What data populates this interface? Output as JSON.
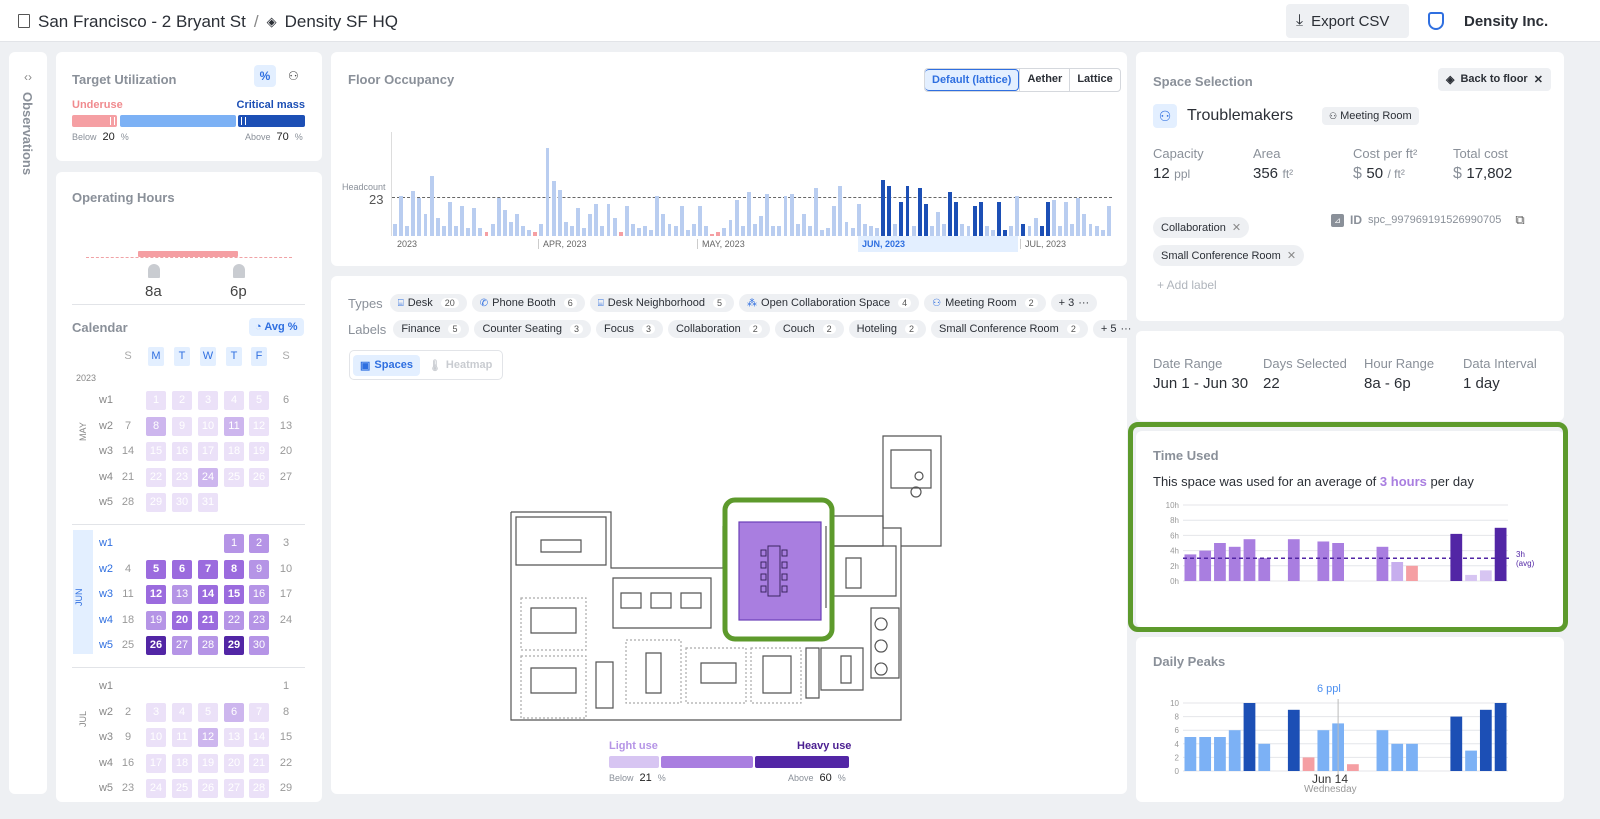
{
  "header": {
    "building": "San Francisco - 2 Bryant St",
    "separator": "/",
    "space": "Density SF HQ",
    "export": "Export CSV",
    "org": "Density Inc."
  },
  "side_tab": {
    "label": "Observations"
  },
  "target": {
    "title": "Target Utilization",
    "pct": "%",
    "underuse": "Underuse",
    "critical": "Critical mass",
    "below": "Below",
    "below_val": "20",
    "above": "Above",
    "above_val": "70",
    "unit": "%",
    "level_low": 0.2,
    "level_high": 0.7
  },
  "hours": {
    "title": "Operating Hours",
    "start": "8a",
    "end": "6p"
  },
  "calendar": {
    "title": "Calendar",
    "avg": "Avg %",
    "year": "2023",
    "days": [
      "S",
      "M",
      "T",
      "W",
      "T",
      "F",
      "S"
    ],
    "months": [
      {
        "name": "MAY",
        "rows": [
          {
            "w": "w1",
            "cells": [
              "",
              "1",
              "2",
              "3",
              "4",
              "5",
              "6"
            ]
          },
          {
            "w": "w2",
            "cells": [
              "7",
              "8",
              "9",
              "10",
              "11",
              "12",
              "13"
            ]
          },
          {
            "w": "w3",
            "cells": [
              "14",
              "15",
              "16",
              "17",
              "18",
              "19",
              "20"
            ]
          },
          {
            "w": "w4",
            "cells": [
              "21",
              "22",
              "23",
              "24",
              "25",
              "26",
              "27"
            ]
          },
          {
            "w": "w5",
            "cells": [
              "28",
              "29",
              "30",
              "31",
              "",
              "",
              ""
            ]
          }
        ]
      },
      {
        "name": "JUN",
        "rows": [
          {
            "w": "w1",
            "cells": [
              "",
              "",
              "",
              "",
              "1",
              "2",
              "3"
            ]
          },
          {
            "w": "w2",
            "cells": [
              "4",
              "5",
              "6",
              "7",
              "8",
              "9",
              "10"
            ]
          },
          {
            "w": "w3",
            "cells": [
              "11",
              "12",
              "13",
              "14",
              "15",
              "16",
              "17"
            ]
          },
          {
            "w": "w4",
            "cells": [
              "18",
              "19",
              "20",
              "21",
              "22",
              "23",
              "24"
            ]
          },
          {
            "w": "w5",
            "cells": [
              "25",
              "26",
              "27",
              "28",
              "29",
              "30",
              ""
            ]
          }
        ]
      },
      {
        "name": "JUL",
        "rows": [
          {
            "w": "w1",
            "cells": [
              "",
              "",
              "",
              "",
              "",
              "",
              "1"
            ]
          },
          {
            "w": "w2",
            "cells": [
              "2",
              "3",
              "4",
              "5",
              "6",
              "7",
              "8"
            ]
          },
          {
            "w": "w3",
            "cells": [
              "9",
              "10",
              "11",
              "12",
              "13",
              "14",
              "15"
            ]
          },
          {
            "w": "w4",
            "cells": [
              "16",
              "17",
              "18",
              "19",
              "20",
              "21",
              "22"
            ]
          },
          {
            "w": "w5",
            "cells": [
              "23",
              "24",
              "25",
              "26",
              "27",
              "28",
              "29"
            ]
          }
        ]
      }
    ]
  },
  "occupancy": {
    "title": "Floor Occupancy",
    "tabs": [
      "Default (lattice)",
      "Aether",
      "Lattice"
    ],
    "ylabel": "Headcount",
    "ref": "23",
    "months": [
      "2023",
      "APR, 2023",
      "MAY, 2023",
      "JUN, 2023",
      "JUL, 2023"
    ]
  },
  "filters": {
    "types_label": "Types",
    "types": [
      {
        "name": "Desk",
        "n": "20",
        "icon": "desk-icon"
      },
      {
        "name": "Phone Booth",
        "n": "6",
        "icon": "phone-icon"
      },
      {
        "name": "Desk Neighborhood",
        "n": "5",
        "icon": "desk-icon"
      },
      {
        "name": "Open Collaboration Space",
        "n": "4",
        "icon": "collab-icon"
      },
      {
        "name": "Meeting Room",
        "n": "2",
        "icon": "meeting-icon"
      }
    ],
    "types_more": "+ 3",
    "labels_label": "Labels",
    "labels": [
      {
        "name": "Finance",
        "n": "5"
      },
      {
        "name": "Counter Seating",
        "n": "3"
      },
      {
        "name": "Focus",
        "n": "3"
      },
      {
        "name": "Collaboration",
        "n": "2"
      },
      {
        "name": "Couch",
        "n": "2"
      },
      {
        "name": "Hoteling",
        "n": "2"
      },
      {
        "name": "Small Conference Room",
        "n": "2"
      }
    ],
    "labels_more": "+ 5",
    "view_spaces": "Spaces",
    "view_heatmap": "Heatmap"
  },
  "legend": {
    "light": "Light use",
    "heavy": "Heavy use",
    "below": "Below",
    "below_val": "21",
    "above": "Above",
    "above_val": "60",
    "unit": "%",
    "level_low": 0.21,
    "level_high": 0.6
  },
  "selection": {
    "title": "Space Selection",
    "back": "Back to floor",
    "name": "Troublemakers",
    "type": "Meeting Room",
    "stats": [
      {
        "label": "Capacity",
        "value": "12",
        "unit": "ppl",
        "prefix": ""
      },
      {
        "label": "Area",
        "value": "356",
        "unit": "ft²",
        "prefix": ""
      },
      {
        "label": "Cost per ft²",
        "value": "50",
        "unit": "/ ft²",
        "prefix": "$"
      },
      {
        "label": "Total cost",
        "value": "17,802",
        "unit": "",
        "prefix": "$"
      }
    ],
    "labels": [
      "Collaboration",
      "Small Conference Room"
    ],
    "add_label": "+ Add label",
    "id_label": "ID",
    "id_value": "spc_997969191526990705"
  },
  "range": {
    "items": [
      {
        "label": "Date Range",
        "value": "Jun 1 - Jun 30"
      },
      {
        "label": "Days Selected",
        "value": "22"
      },
      {
        "label": "Hour Range",
        "value": "8a - 6p"
      },
      {
        "label": "Data Interval",
        "value": "1 day"
      }
    ]
  },
  "time_used": {
    "title": "Time Used",
    "text_pre": "This space was used for an average of",
    "highlight": "3 hours",
    "text_post": "per day",
    "avg_label": "3h",
    "avg_sub": "(avg)"
  },
  "daily_peaks": {
    "title": "Daily Peaks",
    "peak": "6 ppl",
    "date": "Jun 14",
    "day": "Wednesday"
  },
  "chart_data": [
    {
      "type": "bar",
      "title": "Time Used",
      "ylim": [
        0,
        10
      ],
      "yticks": [
        "0h",
        "2h",
        "4h",
        "6h",
        "8h",
        "10h"
      ],
      "avg": 3,
      "values": [
        3.5,
        4,
        5,
        4.5,
        5.5,
        3,
        0,
        5.5,
        0,
        5.2,
        5,
        0,
        0,
        4.5,
        2.5,
        2,
        0,
        0,
        6.2,
        0.8,
        1.4,
        7
      ]
    },
    {
      "type": "bar",
      "title": "Daily Peaks",
      "ylim": [
        0,
        10
      ],
      "yticks": [
        "0",
        "2",
        "4",
        "6",
        "8",
        "10"
      ],
      "values": [
        5,
        5,
        5,
        6,
        10,
        4,
        0,
        9,
        2,
        6,
        7,
        1,
        0,
        6,
        4,
        4,
        0,
        0,
        8,
        3,
        9,
        10
      ]
    }
  ]
}
